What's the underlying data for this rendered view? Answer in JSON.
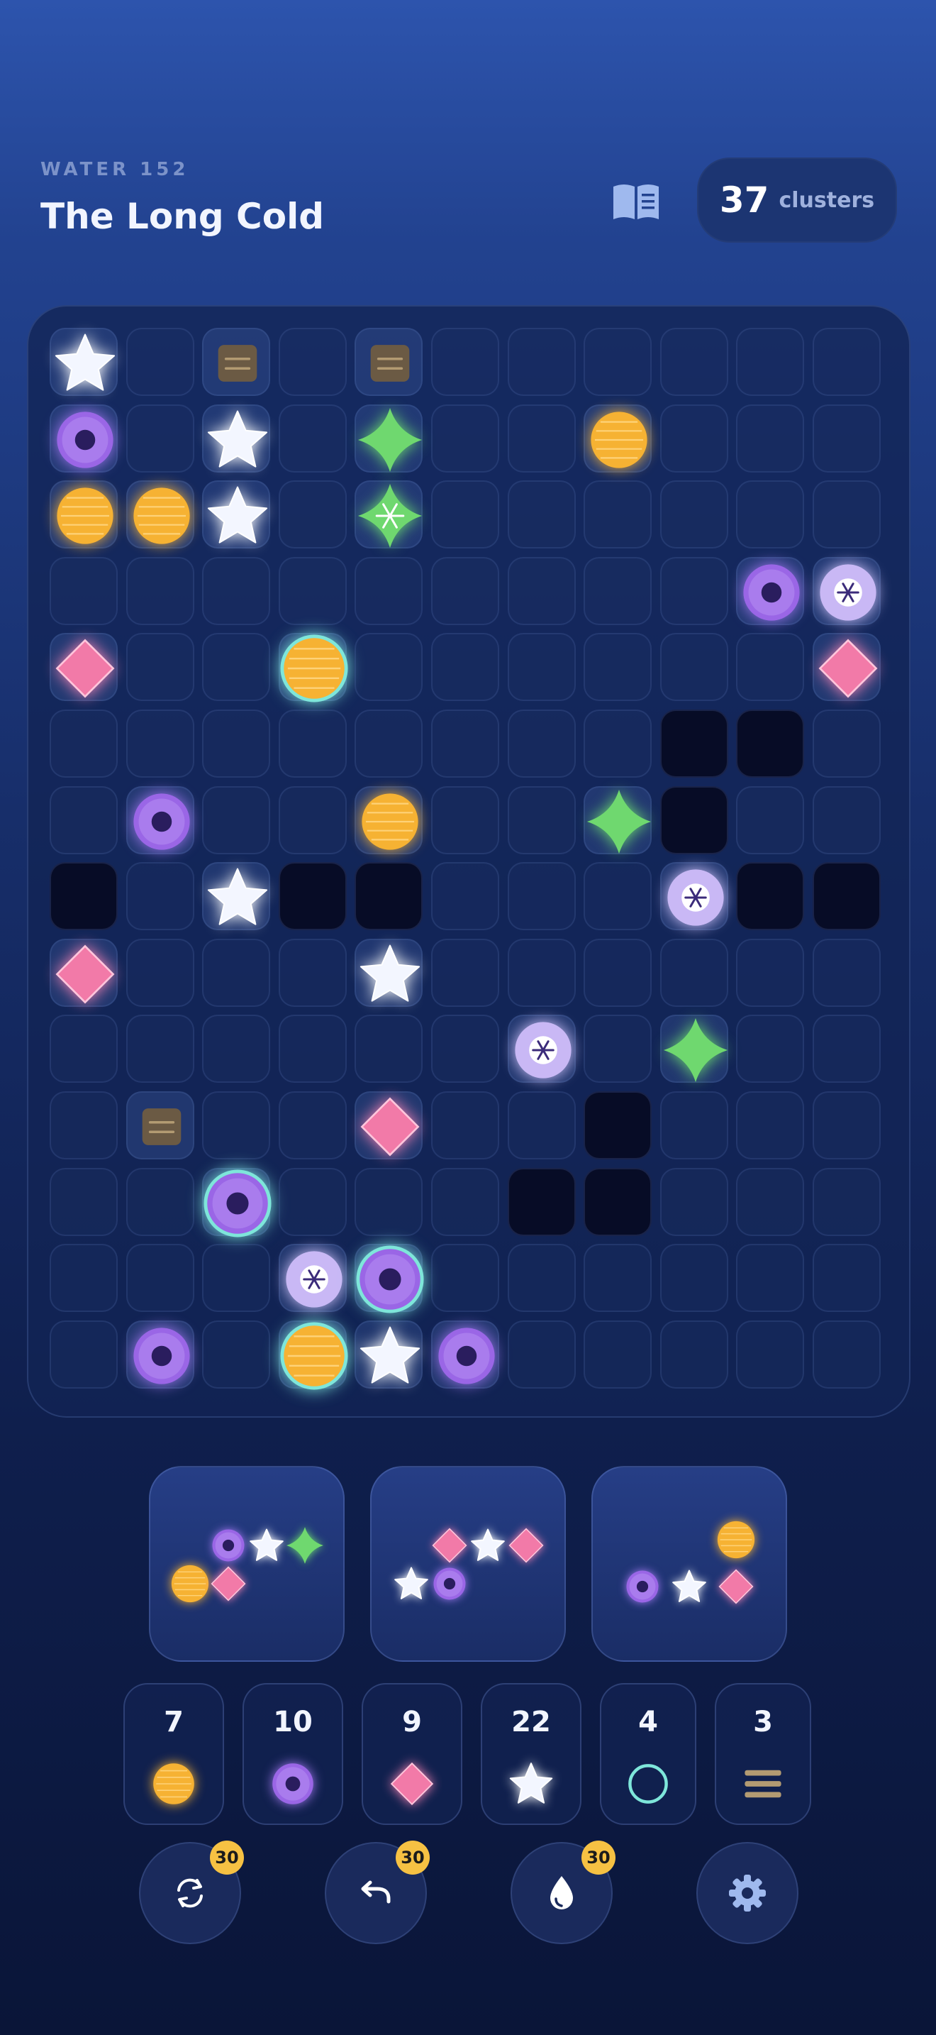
{
  "header": {
    "subtitle": "WATER 152",
    "title": "The Long Cold",
    "clusters_count": "37",
    "clusters_label": "clusters"
  },
  "board": {
    "rows": 14,
    "cols": 11,
    "holes": [
      [
        5,
        8
      ],
      [
        5,
        9
      ],
      [
        6,
        8
      ],
      [
        7,
        0
      ],
      [
        7,
        3
      ],
      [
        7,
        4
      ],
      [
        7,
        9
      ],
      [
        7,
        10
      ],
      [
        10,
        7
      ],
      [
        11,
        6
      ],
      [
        11,
        7
      ]
    ],
    "pieces": [
      [
        0,
        0,
        "star"
      ],
      [
        0,
        2,
        "block"
      ],
      [
        0,
        4,
        "block"
      ],
      [
        1,
        0,
        "ring"
      ],
      [
        1,
        2,
        "star"
      ],
      [
        1,
        4,
        "sparkle"
      ],
      [
        1,
        7,
        "orb"
      ],
      [
        2,
        0,
        "orb"
      ],
      [
        2,
        1,
        "orb"
      ],
      [
        2,
        2,
        "star"
      ],
      [
        2,
        4,
        "sparkle-snow"
      ],
      [
        3,
        9,
        "ring"
      ],
      [
        3,
        10,
        "snow"
      ],
      [
        4,
        0,
        "diamond"
      ],
      [
        4,
        3,
        "orb-teal"
      ],
      [
        4,
        10,
        "diamond"
      ],
      [
        6,
        1,
        "ring"
      ],
      [
        6,
        4,
        "orb"
      ],
      [
        6,
        7,
        "sparkle"
      ],
      [
        7,
        2,
        "star"
      ],
      [
        7,
        8,
        "snow"
      ],
      [
        8,
        0,
        "diamond"
      ],
      [
        8,
        4,
        "star"
      ],
      [
        9,
        6,
        "snow"
      ],
      [
        9,
        8,
        "sparkle"
      ],
      [
        10,
        1,
        "block"
      ],
      [
        10,
        4,
        "diamond"
      ],
      [
        11,
        2,
        "ring-teal"
      ],
      [
        12,
        3,
        "snow"
      ],
      [
        12,
        4,
        "ring-teal"
      ],
      [
        13,
        1,
        "ring"
      ],
      [
        13,
        3,
        "orb-teal"
      ],
      [
        13,
        4,
        "star"
      ],
      [
        13,
        5,
        "ring"
      ]
    ]
  },
  "trays": [
    {
      "pieces": [
        [
          "ring",
          110,
          110
        ],
        [
          "star",
          164,
          110
        ],
        [
          "sparkle",
          218,
          110
        ],
        [
          "orb",
          56,
          164
        ],
        [
          "diamond",
          110,
          164
        ]
      ]
    },
    {
      "pieces": [
        [
          "diamond",
          110,
          110
        ],
        [
          "star",
          164,
          110
        ],
        [
          "diamond",
          218,
          110
        ],
        [
          "star",
          56,
          164
        ],
        [
          "ring",
          110,
          164
        ]
      ]
    },
    {
      "pieces": [
        [
          "orb",
          202,
          102
        ],
        [
          "ring",
          70,
          168
        ],
        [
          "star",
          136,
          168
        ],
        [
          "diamond",
          202,
          168
        ]
      ]
    }
  ],
  "counts": [
    {
      "value": "7",
      "icon": "orb"
    },
    {
      "value": "10",
      "icon": "ring"
    },
    {
      "value": "9",
      "icon": "diamond"
    },
    {
      "value": "22",
      "icon": "star"
    },
    {
      "value": "4",
      "icon": "teal-circle"
    },
    {
      "value": "3",
      "icon": "block"
    }
  ],
  "actions": [
    {
      "name": "shuffle",
      "badge": "30"
    },
    {
      "name": "undo",
      "badge": "30"
    },
    {
      "name": "drop",
      "badge": "30"
    },
    {
      "name": "settings",
      "badge": ""
    }
  ],
  "colors": {
    "orb": "#f6b233",
    "ring": "#9a66e6",
    "diamond": "#f27aa8",
    "star": "#f3f6ff",
    "sparkle": "#6fd86f",
    "teal": "#7ee6da",
    "block": "#6b5a44"
  }
}
